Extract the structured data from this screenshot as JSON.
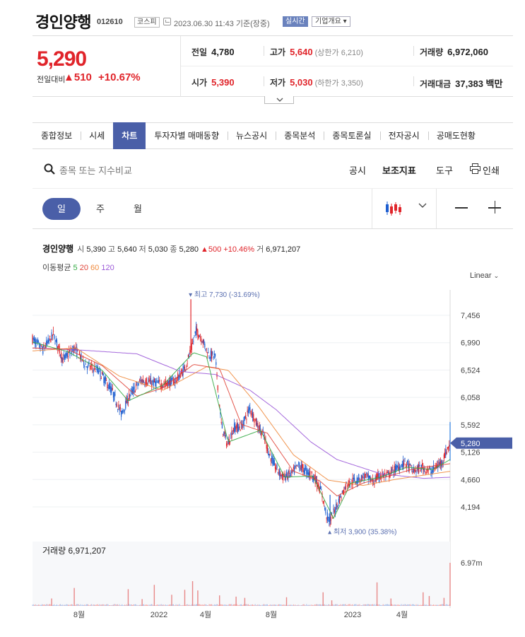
{
  "header": {
    "name": "경인양행",
    "code": "012610",
    "market": "코스피",
    "timestamp": "2023.06.30 11:43 기준(장중)",
    "realtime": "실시간",
    "company_btn": "기업개요 ▾"
  },
  "quote": {
    "price": "5,290",
    "change_label": "전일대비",
    "change_abs": "▲510",
    "change_pct": "+10.67%",
    "prev_label": "전일",
    "prev": "4,780",
    "high_label": "고가",
    "high": "5,640",
    "upper_limit": "(상한가 6,210)",
    "volume_label": "거래량",
    "volume": "6,972,060",
    "open_label": "시가",
    "open": "5,390",
    "low_label": "저가",
    "low": "5,030",
    "lower_limit": "(하한가 3,350)",
    "amount_label": "거래대금",
    "amount": "37,383 백만"
  },
  "tabs": [
    "종합정보",
    "시세",
    "차트",
    "투자자별 매매동향",
    "뉴스공시",
    "종목분석",
    "종목토론실",
    "전자공시",
    "공매도현황"
  ],
  "active_tab": "차트",
  "toolbar": {
    "search_placeholder": "종목 또는 지수비교",
    "disclosure": "공시",
    "indicator": "보조지표",
    "tools": "도구",
    "print": "인쇄"
  },
  "periods": [
    "일",
    "주",
    "월"
  ],
  "active_period": "일",
  "legend": {
    "name": "경인양행",
    "open_label": "시",
    "open": "5,390",
    "high_label": "고",
    "high": "5,640",
    "low_label": "저",
    "low": "5,030",
    "close_label": "종",
    "close": "5,280",
    "change": "▲500 +10.46%",
    "volume_label": "거",
    "volume": "6,971,207",
    "ma_label": "이동평균",
    "ma": [
      {
        "period": "5",
        "color": "#33aa44"
      },
      {
        "period": "20",
        "color": "#e0453a"
      },
      {
        "period": "60",
        "color": "#f08a3c"
      },
      {
        "period": "120",
        "color": "#9b59d8"
      }
    ]
  },
  "scale": "Linear",
  "colors": {
    "up": "#e0242a",
    "down": "#1e5fd0",
    "accent": "#4a5fa8"
  },
  "chart_data": {
    "type": "candlestick",
    "y_ticks": [
      "7,456",
      "6,990",
      "6,524",
      "6,058",
      "5,592",
      "5,126",
      "4,660",
      "4,194"
    ],
    "y_tick_values": [
      7456,
      6990,
      6524,
      6058,
      5592,
      5126,
      4660,
      4194
    ],
    "x_ticks": [
      "8월",
      "2022",
      "4월",
      "8월",
      "2023",
      "4월"
    ],
    "current_price_label": "5,280",
    "max_label": "최고 7,730 (-31.69%)",
    "min_label": "최저 3,900 (35.38%)",
    "anchors": [
      [
        0,
        7050
      ],
      [
        12,
        6870
      ],
      [
        24,
        7130
      ],
      [
        35,
        6700
      ],
      [
        48,
        6900
      ],
      [
        62,
        6600
      ],
      [
        76,
        6520
      ],
      [
        92,
        6150
      ],
      [
        102,
        5780
      ],
      [
        112,
        6100
      ],
      [
        125,
        6350
      ],
      [
        140,
        6300
      ],
      [
        152,
        6280
      ],
      [
        165,
        6350
      ],
      [
        175,
        6550
      ],
      [
        182,
        6850
      ],
      [
        188,
        7200
      ],
      [
        195,
        7050
      ],
      [
        202,
        6800
      ],
      [
        210,
        6750
      ],
      [
        217,
        5600
      ],
      [
        224,
        5250
      ],
      [
        232,
        5550
      ],
      [
        240,
        5550
      ],
      [
        250,
        5880
      ],
      [
        258,
        5600
      ],
      [
        266,
        5400
      ],
      [
        272,
        5100
      ],
      [
        280,
        4850
      ],
      [
        288,
        4700
      ],
      [
        298,
        4760
      ],
      [
        306,
        4900
      ],
      [
        315,
        4800
      ],
      [
        324,
        4700
      ],
      [
        332,
        4450
      ],
      [
        338,
        4050
      ],
      [
        342,
        3950
      ],
      [
        352,
        4300
      ],
      [
        362,
        4600
      ],
      [
        372,
        4650
      ],
      [
        382,
        4720
      ],
      [
        392,
        4620
      ],
      [
        400,
        4740
      ],
      [
        408,
        4720
      ],
      [
        418,
        4850
      ],
      [
        428,
        4950
      ],
      [
        438,
        4800
      ],
      [
        448,
        4870
      ],
      [
        458,
        4800
      ],
      [
        470,
        4950
      ],
      [
        480,
        5280
      ]
    ],
    "ma5": [
      [
        0,
        7000
      ],
      [
        40,
        6840
      ],
      [
        80,
        6520
      ],
      [
        110,
        6000
      ],
      [
        150,
        6270
      ],
      [
        185,
        6820
      ],
      [
        200,
        6750
      ],
      [
        225,
        5300
      ],
      [
        262,
        5500
      ],
      [
        290,
        4700
      ],
      [
        322,
        4720
      ],
      [
        346,
        4000
      ],
      [
        366,
        4600
      ],
      [
        400,
        4700
      ],
      [
        430,
        4870
      ],
      [
        460,
        4830
      ],
      [
        480,
        5000
      ]
    ],
    "ma20": [
      [
        0,
        6900
      ],
      [
        40,
        6880
      ],
      [
        80,
        6600
      ],
      [
        120,
        6080
      ],
      [
        150,
        6220
      ],
      [
        185,
        6620
      ],
      [
        215,
        6550
      ],
      [
        240,
        5600
      ],
      [
        270,
        5450
      ],
      [
        300,
        4800
      ],
      [
        330,
        4640
      ],
      [
        350,
        4380
      ],
      [
        380,
        4600
      ],
      [
        410,
        4720
      ],
      [
        440,
        4850
      ],
      [
        480,
        4930
      ]
    ],
    "ma60": [
      [
        0,
        6850
      ],
      [
        50,
        6900
      ],
      [
        100,
        6420
      ],
      [
        150,
        6180
      ],
      [
        200,
        6580
      ],
      [
        225,
        6520
      ],
      [
        260,
        5900
      ],
      [
        300,
        5080
      ],
      [
        340,
        4650
      ],
      [
        380,
        4560
      ],
      [
        420,
        4670
      ],
      [
        480,
        4800
      ]
    ],
    "ma120": [
      [
        0,
        6900
      ],
      [
        60,
        6860
      ],
      [
        120,
        6800
      ],
      [
        170,
        6500
      ],
      [
        210,
        6450
      ],
      [
        250,
        6180
      ],
      [
        280,
        5850
      ],
      [
        320,
        5300
      ],
      [
        350,
        5000
      ],
      [
        400,
        4760
      ],
      [
        450,
        4680
      ],
      [
        480,
        4700
      ]
    ],
    "volume_label": "거래량 6,971,207",
    "volume_axis_label": "6.97m",
    "volume_max": 6971207,
    "volume_spikes": [
      [
        22,
        1200000
      ],
      [
        48,
        2900000
      ],
      [
        110,
        2700000
      ],
      [
        126,
        1100000
      ],
      [
        140,
        3400000
      ],
      [
        160,
        1800000
      ],
      [
        175,
        2600000
      ],
      [
        184,
        4000000
      ],
      [
        190,
        2500000
      ],
      [
        215,
        1700000
      ],
      [
        234,
        1500000
      ],
      [
        244,
        1300000
      ],
      [
        292,
        1400000
      ],
      [
        334,
        2200000
      ],
      [
        344,
        900000
      ],
      [
        396,
        3800000
      ],
      [
        412,
        1200000
      ],
      [
        449,
        2200000
      ],
      [
        456,
        1600000
      ],
      [
        473,
        1300000
      ],
      [
        480,
        6971207
      ]
    ],
    "ma_labels_note": "",
    "xlabel": "",
    "ylabel": ""
  }
}
